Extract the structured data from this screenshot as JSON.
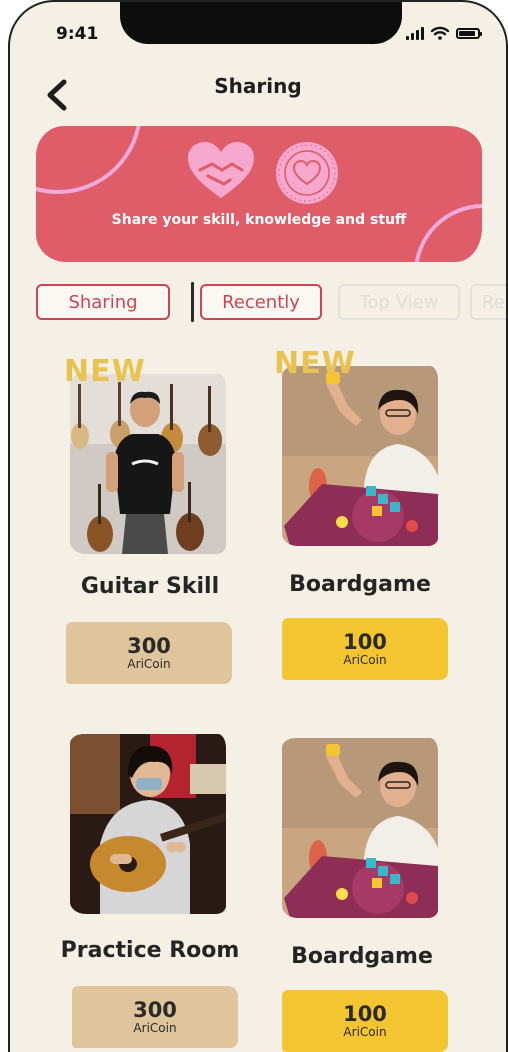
{
  "status_bar": {
    "time": "9:41"
  },
  "header": {
    "title": "Sharing",
    "back_icon": "chevron-left-icon"
  },
  "banner": {
    "tagline": "Share your skill, knowledge and stuff",
    "icons": [
      "heart-handshake-icon",
      "seal-logo-icon"
    ],
    "background_color": "#de5d69"
  },
  "tabs": [
    {
      "label": "Sharing",
      "active": true
    },
    {
      "label": "Recently",
      "active": true
    },
    {
      "label": "Top View",
      "active": false
    },
    {
      "label": "Re",
      "active": false
    }
  ],
  "items": [
    {
      "title": "Guitar Skill",
      "badge": "NEW",
      "price": "300",
      "unit": "AriCoin",
      "photo": "man-with-guitars-photo",
      "price_color": "#e0c49b"
    },
    {
      "title": "Boardgame",
      "badge": "NEW",
      "price": "100",
      "unit": "AriCoin",
      "photo": "girl-playing-boardgame-photo",
      "price_color": "#f3c531"
    },
    {
      "title": "Practice Room",
      "badge": "",
      "price": "300",
      "unit": "AriCoin",
      "photo": "girl-playing-guitar-photo",
      "price_color": "#e0c49b"
    },
    {
      "title": "Boardgame",
      "badge": "",
      "price": "100",
      "unit": "AriCoin",
      "photo": "girl-playing-boardgame-photo",
      "price_color": "#f3c531"
    }
  ]
}
